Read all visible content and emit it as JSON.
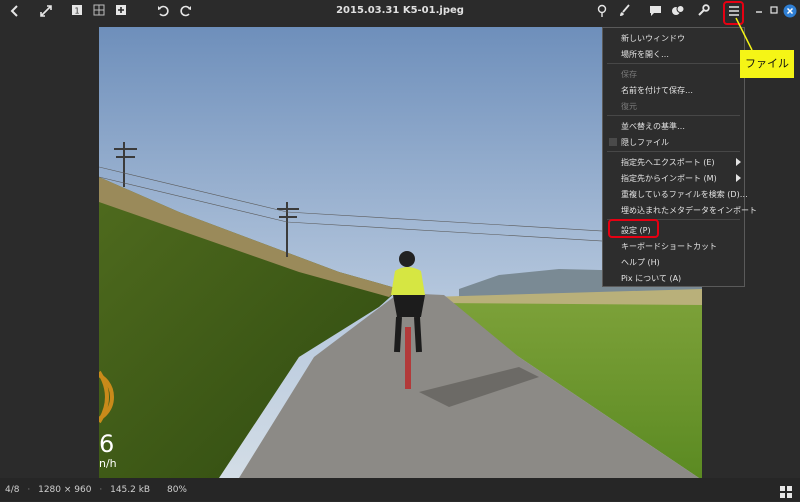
{
  "window": {
    "title": "2015.03.31 K5-01.jpeg"
  },
  "toolbar": {
    "back_icon": "chevron-left-icon",
    "fullscreen_icon": "expand-icon",
    "view1_icon": "view-single-icon",
    "view2_icon": "view-grid-icon",
    "add_icon": "add-icon",
    "rotate_left_icon": "rotate-left-icon",
    "rotate_right_icon": "rotate-right-icon",
    "location_icon": "pin-icon",
    "edit_icon": "brush-icon",
    "comment_icon": "comment-icon",
    "share_icon": "share-icon",
    "tools_icon": "wrench-icon",
    "menu_icon": "hamburger-menu-icon"
  },
  "menu": {
    "items": [
      {
        "label": "新しいウィンドウ",
        "enabled": true
      },
      {
        "label": "場所を開く…",
        "enabled": true
      },
      {
        "label": "保存",
        "enabled": false
      },
      {
        "label": "名前を付けて保存…",
        "enabled": true
      },
      {
        "label": "復元",
        "enabled": false
      },
      {
        "label": "並べ替えの基準…",
        "enabled": true
      },
      {
        "label": "隠しファイル",
        "enabled": true
      },
      {
        "label": "指定先へエクスポート (E)",
        "enabled": true
      },
      {
        "label": "指定先からインポート (M)",
        "enabled": true
      },
      {
        "label": "重複しているファイルを検索 (D)…",
        "enabled": true
      },
      {
        "label": "埋め込まれたメタデータをインポート",
        "enabled": true
      },
      {
        "label": "設定 (P)",
        "enabled": true
      },
      {
        "label": "キーボードショートカット",
        "enabled": true
      },
      {
        "label": "ヘルプ (H)",
        "enabled": true
      },
      {
        "label": "Pix について (A)",
        "enabled": true
      }
    ]
  },
  "callout": {
    "label": "ファイル"
  },
  "overlay": {
    "speed_value": "6",
    "speed_unit": "n/h"
  },
  "status": {
    "position": "4/8",
    "dimensions": "1280 × 960",
    "size": "145.2 kB",
    "zoom": "80%"
  },
  "colors": {
    "highlight": "#e60012",
    "callout": "#f5f516",
    "background": "#2b2b2b"
  }
}
